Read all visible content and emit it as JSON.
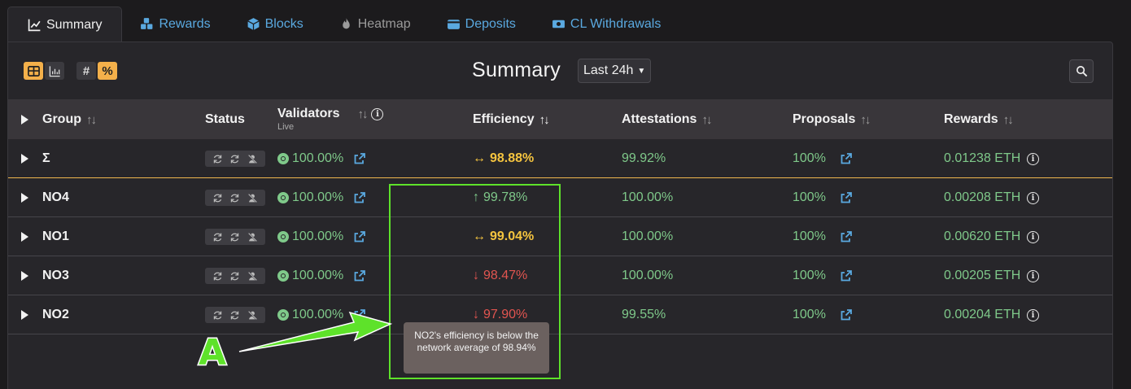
{
  "tabs": [
    {
      "label": "Summary",
      "icon": "line-chart-icon",
      "active": true
    },
    {
      "label": "Rewards",
      "icon": "cubes-icon"
    },
    {
      "label": "Blocks",
      "icon": "cube-icon"
    },
    {
      "label": "Heatmap",
      "icon": "fire-icon",
      "disabled": true
    },
    {
      "label": "Deposits",
      "icon": "wallet-icon"
    },
    {
      "label": "CL Withdrawals",
      "icon": "money-bill-icon"
    }
  ],
  "header": {
    "title": "Summary",
    "range_select": "Last 24h",
    "view_toggles": [
      "table-view-icon",
      "chart-view-icon"
    ],
    "unit_toggles": [
      "#",
      "%"
    ]
  },
  "columns": {
    "group": "Group",
    "status": "Status",
    "validators": "Validators",
    "validators_sub": "Live",
    "efficiency": "Efficiency",
    "attestations": "Attestations",
    "proposals": "Proposals",
    "rewards": "Rewards"
  },
  "rows": [
    {
      "group": "Σ",
      "validators": "100.00%",
      "efficiency": "98.88%",
      "trend": "↔",
      "attestations": "99.92%",
      "proposals": "100%",
      "rewards": "0.01238 ETH"
    },
    {
      "group": "NO4",
      "validators": "100.00%",
      "efficiency": "99.78%",
      "trend": "↑",
      "attestations": "100.00%",
      "proposals": "100%",
      "rewards": "0.00208 ETH"
    },
    {
      "group": "NO1",
      "validators": "100.00%",
      "efficiency": "99.04%",
      "trend": "↔",
      "attestations": "100.00%",
      "proposals": "100%",
      "rewards": "0.00620 ETH"
    },
    {
      "group": "NO3",
      "validators": "100.00%",
      "efficiency": "98.47%",
      "trend": "↓",
      "attestations": "100.00%",
      "proposals": "100%",
      "rewards": "0.00205 ETH"
    },
    {
      "group": "NO2",
      "validators": "100.00%",
      "efficiency": "97.90%",
      "trend": "↓",
      "attestations": "99.55%",
      "proposals": "100%",
      "rewards": "0.00204 ETH"
    }
  ],
  "tooltip": "NO2's efficiency is below the network average of 98.94%",
  "annotation": {
    "marker": "A"
  },
  "colors": {
    "accent": "#f4b04a",
    "good": "#7fc98a",
    "neutral": "#f5c43f",
    "bad": "#e25550",
    "link": "#5aa9e0",
    "annotation": "#5ee22a"
  }
}
